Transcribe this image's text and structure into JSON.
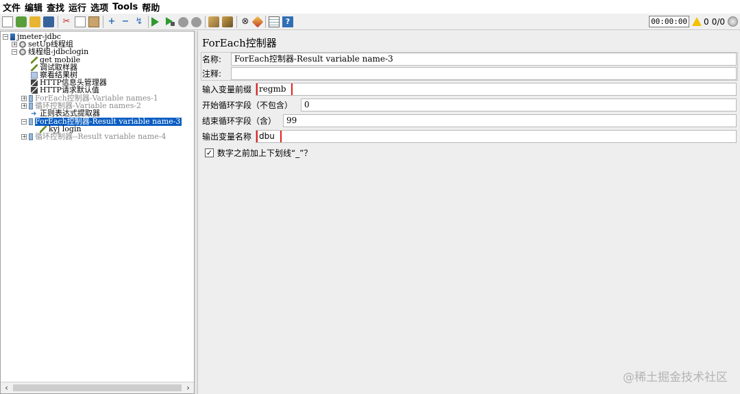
{
  "menu": [
    "文件",
    "编辑",
    "查找",
    "运行",
    "选项",
    "Tools",
    "帮助"
  ],
  "toolbar": {
    "timer": "00:00:00",
    "warning_count": "0",
    "threads": "0/0"
  },
  "tree": {
    "plan": "jmeter-jdbc",
    "setup_group": "setUp线程组",
    "thread_group": "线程组-jdbclogin",
    "get_mobile": "get mobile",
    "debug_sampler": "调试取样器",
    "result_tree": "察看结果树",
    "header_manager": "HTTP信息头管理器",
    "http_defaults": "HTTP请求默认值",
    "foreach1": "ForEach控制器-Variable names-1",
    "loop2": "循环控制器-Variable names-2",
    "regex_extractor": "正则表达式提取器",
    "foreach3": "ForEach控制器-Result variable name-3",
    "kyj_login": "kyj login",
    "loop4": "循环控制器--Result variable name-4"
  },
  "editor": {
    "title": "ForEach控制器",
    "name_label": "名称:",
    "name_value": "ForEach控制器-Result variable name-3",
    "comment_label": "注释:",
    "comment_value": "",
    "input_prefix_label": "输入变量前缀",
    "input_prefix_value": "regmb",
    "start_label": "开始循环字段（不包含）",
    "start_value": "0",
    "end_label": "结束循环字段（含）",
    "end_value": "99",
    "output_label": "输出变量名称",
    "output_value": "dbu",
    "underscore_label": "数字之前加上下划线“_”？",
    "underscore_checked": true
  },
  "watermark": "@稀土掘金技术社区"
}
